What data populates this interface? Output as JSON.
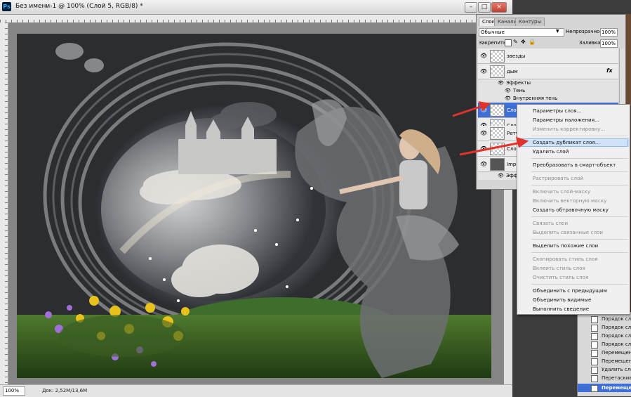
{
  "window": {
    "title": "Без имени-1 @ 100% (Слой 5, RGB/8) *",
    "app_icon": "Ps",
    "buttons": [
      "–",
      "□",
      "×"
    ]
  },
  "status": {
    "zoom": "100%",
    "doc_size": "Док: 2,52М/13,6М"
  },
  "layers_panel": {
    "tabs": [
      "Слои",
      "Каналы",
      "Контуры"
    ],
    "blend_mode": "Обычные",
    "opacity_label": "Непрозрачность:",
    "opacity_value": "100%",
    "lock_label": "Закрепить:",
    "fill_label": "Заливка:",
    "fill_value": "100%",
    "layers": [
      {
        "name": "звезды"
      },
      {
        "name": "дым",
        "fx": "fx"
      },
      {
        "name": "Слой",
        "selected": true
      },
      {
        "name": "Слой"
      },
      {
        "name": "Ретуш"
      },
      {
        "name": "Слой"
      },
      {
        "name": "Impa"
      }
    ],
    "effects_label": "Эффекты",
    "effects": [
      "Тень",
      "Внутренняя тень"
    ],
    "effects2_label": "Эффе"
  },
  "context_menu": {
    "items": [
      {
        "label": "Параметры слоя...",
        "disabled": false
      },
      {
        "label": "Параметры наложения...",
        "disabled": false
      },
      {
        "label": "Изменить корректировку...",
        "disabled": true
      },
      {
        "separator": true
      },
      {
        "label": "Создать дубликат слоя...",
        "disabled": false,
        "highlighted": true
      },
      {
        "label": "Удалить слой",
        "disabled": false
      },
      {
        "separator": true
      },
      {
        "label": "Преобразовать в смарт-объект",
        "disabled": false
      },
      {
        "separator": true
      },
      {
        "label": "Растрировать слой",
        "disabled": true
      },
      {
        "separator": true
      },
      {
        "label": "Включить слой-маску",
        "disabled": true
      },
      {
        "label": "Включить векторную маску",
        "disabled": true
      },
      {
        "label": "Создать обтравочную маску",
        "disabled": false
      },
      {
        "separator": true
      },
      {
        "label": "Связать слои",
        "disabled": true
      },
      {
        "label": "Выделить связанные слои",
        "disabled": true
      },
      {
        "separator": true
      },
      {
        "label": "Выделить похожие слои",
        "disabled": false
      },
      {
        "separator": true
      },
      {
        "label": "Скопировать стиль слоя",
        "disabled": true
      },
      {
        "label": "Вклеить стиль слоя",
        "disabled": true
      },
      {
        "label": "Очистить стиль слоя",
        "disabled": true
      },
      {
        "separator": true
      },
      {
        "label": "Объединить с предыдущим",
        "disabled": false
      },
      {
        "label": "Объединить видимые",
        "disabled": false
      },
      {
        "label": "Выполнить сведение",
        "disabled": false
      }
    ]
  },
  "history_panel": {
    "items": [
      {
        "label": "Порядок слое"
      },
      {
        "label": "Порядок слое"
      },
      {
        "label": "Порядок слое"
      },
      {
        "label": "Порядок слое"
      },
      {
        "label": "Перемещение"
      },
      {
        "label": "Перемещение"
      },
      {
        "label": "Удалить слой"
      },
      {
        "label": "Перетаскиван"
      },
      {
        "label": "Перемещение",
        "selected": true
      }
    ]
  },
  "colors": {
    "selection": "#3e6fd6",
    "arrow": "#e0332a",
    "menu_highlight": "#cfe2f7"
  }
}
